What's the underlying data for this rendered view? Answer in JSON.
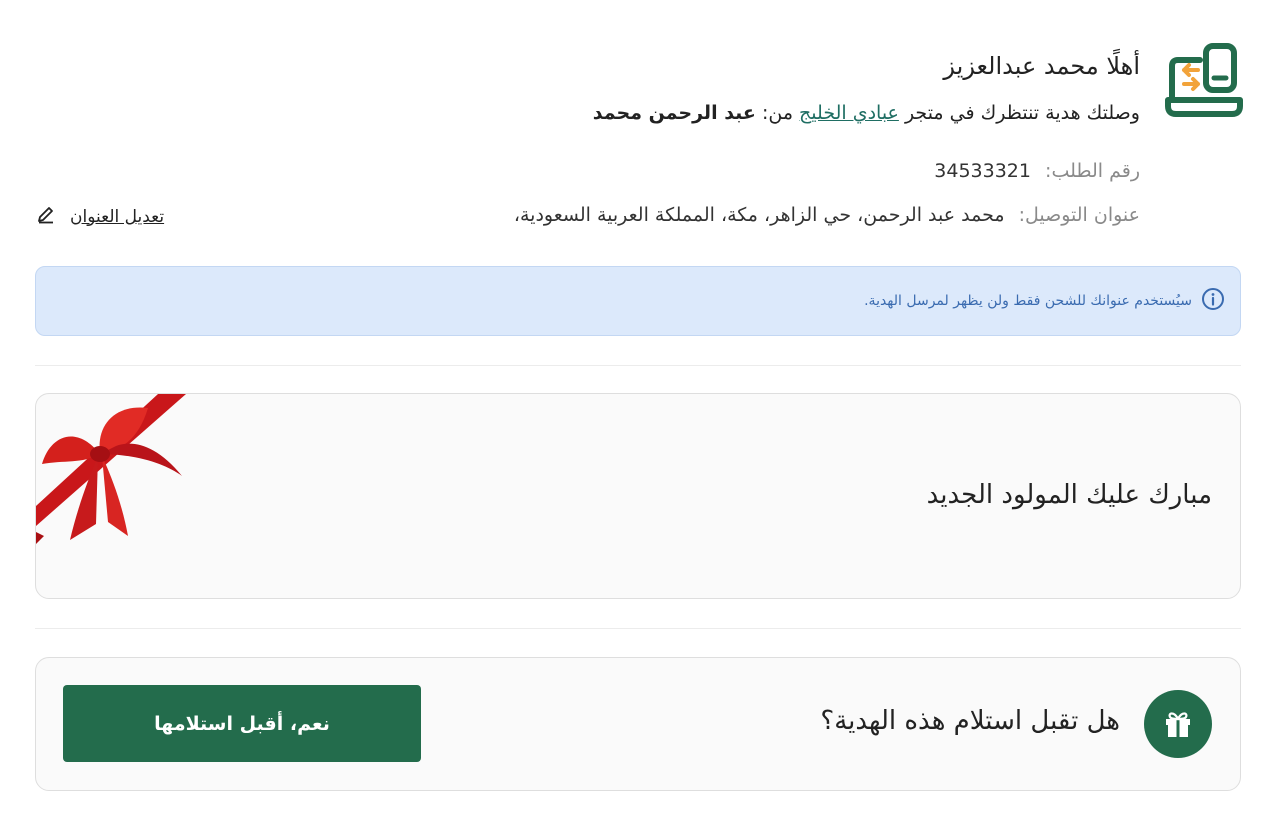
{
  "header": {
    "greeting": "أهلًا محمد عبدالعزيز",
    "gift_prefix": "وصلتك هدية تنتظرك في متجر",
    "store_name": "عبادي الخليج",
    "from_label": "من:",
    "sender_name": "عبد الرحمن محمد",
    "order_label": "رقم الطلب:",
    "order_number": "34533321",
    "address_label": "عنوان التوصيل:",
    "address_value": "محمد عبد الرحمن، حي الزاهر، مكة، المملكة العربية السعودية،",
    "edit_address_label": "تعديل العنوان"
  },
  "info_banner": {
    "text": "سيُستخدم عنوانك للشحن فقط ولن يظهر لمرسل الهدية."
  },
  "gift_message": {
    "text": "مبارك عليك المولود الجديد"
  },
  "accept": {
    "question": "هل تقبل استلام هذه الهدية؟",
    "button_label": "نعم، أقبل استلامها"
  },
  "colors": {
    "brand_green": "#236c4c",
    "logo_orange": "#f2a33a",
    "link_teal": "#1f6e63",
    "info_bg": "#dce9fb",
    "info_text": "#3a6bb0",
    "ribbon_red": "#d4201c"
  },
  "icons": {
    "logo": "store-exchange-logo-icon",
    "edit": "pencil-icon",
    "info": "info-circle-icon",
    "gift": "gift-icon",
    "ribbon": "gift-ribbon-bow-icon"
  }
}
